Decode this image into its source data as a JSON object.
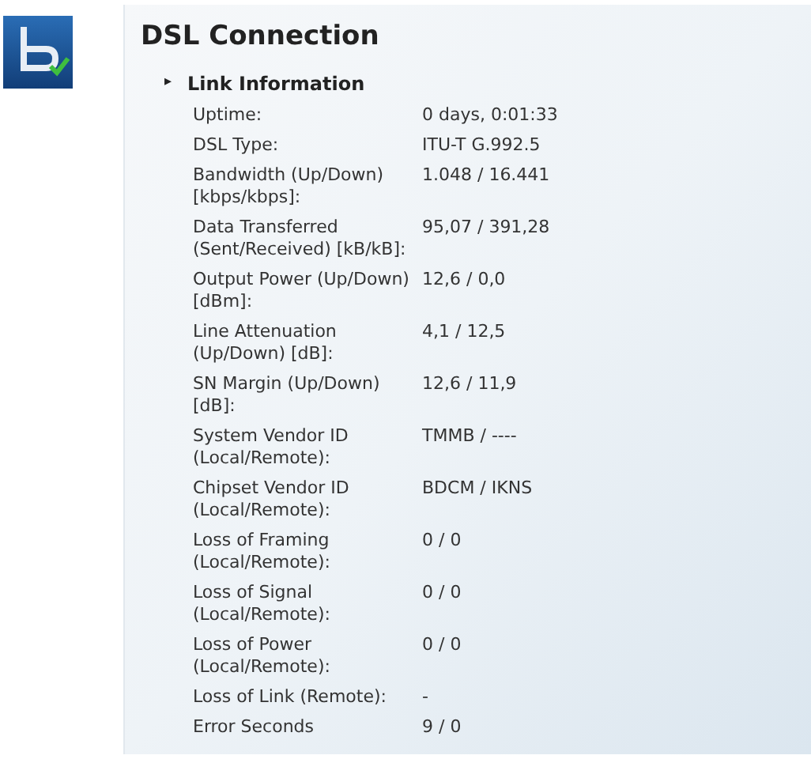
{
  "title": "DSL Connection",
  "section": {
    "marker": "▸",
    "title": "Link Information"
  },
  "rows": [
    {
      "label": "Uptime:",
      "value": "0 days, 0:01:33"
    },
    {
      "label": "DSL Type:",
      "value": "ITU-T G.992.5"
    },
    {
      "label": "Bandwidth (Up/Down) [kbps/kbps]:",
      "value": "1.048 / 16.441"
    },
    {
      "label": "Data Transferred (Sent/Received) [kB/kB]:",
      "value": "95,07 / 391,28"
    },
    {
      "label": "Output Power (Up/Down) [dBm]:",
      "value": "12,6 / 0,0"
    },
    {
      "label": "Line Attenuation (Up/Down) [dB]:",
      "value": "4,1 / 12,5"
    },
    {
      "label": "SN Margin (Up/Down) [dB]:",
      "value": "12,6 / 11,9"
    },
    {
      "label": "System Vendor ID (Local/Remote):",
      "value": "TMMB / ----"
    },
    {
      "label": "Chipset Vendor ID (Local/Remote):",
      "value": "BDCM / IKNS"
    },
    {
      "label": "Loss of Framing (Local/Remote):",
      "value": "0 / 0"
    },
    {
      "label": "Loss of Signal (Local/Remote):",
      "value": "0 / 0"
    },
    {
      "label": "Loss of Power (Local/Remote):",
      "value": "0 / 0"
    },
    {
      "label": "Loss of Link (Remote):",
      "value": "-"
    },
    {
      "label": "Error Seconds",
      "value": "9 / 0"
    }
  ]
}
